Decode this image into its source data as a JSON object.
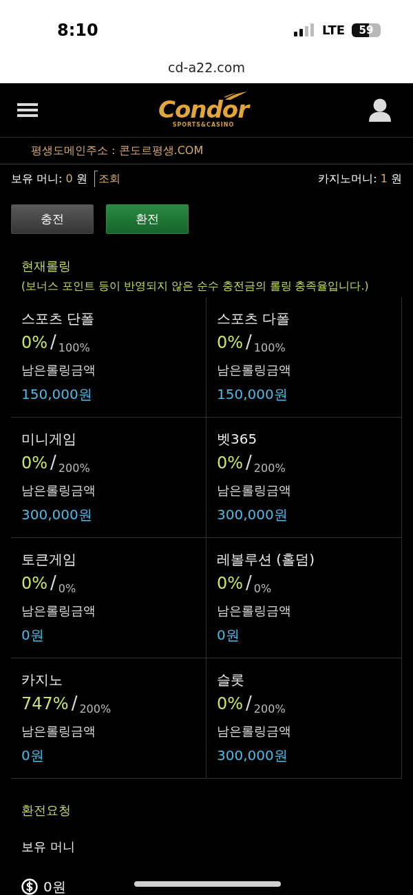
{
  "status_bar": {
    "time": "8:10",
    "network": "LTE",
    "battery": "59"
  },
  "browser": {
    "url": "cd-a22.com"
  },
  "header": {
    "logo": "Condor",
    "tagline": "SPORTS&CASINO"
  },
  "notice": "평생도메인주소 : 콘도르평생.COM",
  "balances": {
    "holding": {
      "label": "보유 머니:",
      "amount": "0",
      "unit": "원"
    },
    "lookup": "조회",
    "casino": {
      "label": "카지노머니:",
      "amount": "1",
      "unit": "원"
    }
  },
  "actions": [
    {
      "label": "충전",
      "selected": false
    },
    {
      "label": "환전",
      "selected": true
    }
  ],
  "rolling": {
    "title": "현재롤링",
    "note": "(보너스 포인트 등이 반영되지 않은 순수 충전금의 롤링 충족율입니다.)",
    "cells": [
      {
        "name": "스포츠 단폴",
        "current": "0%",
        "separator": "/",
        "target": "100%",
        "remaining_label": "남은롤링금액",
        "remaining": "150,000원"
      },
      {
        "name": "스포츠 다폴",
        "current": "0%",
        "separator": "/",
        "target": "100%",
        "remaining_label": "남은롤링금액",
        "remaining": "150,000원"
      },
      {
        "name": "미니게임",
        "current": "0%",
        "separator": "/",
        "target": "200%",
        "remaining_label": "남은롤링금액",
        "remaining": "300,000원"
      },
      {
        "name": "벳365",
        "current": "0%",
        "separator": "/",
        "target": "200%",
        "remaining_label": "남은롤링금액",
        "remaining": "300,000원"
      },
      {
        "name": "토큰게임",
        "current": "0%",
        "separator": "/",
        "target": "0%",
        "remaining_label": "남은롤링금액",
        "remaining": "0원"
      },
      {
        "name": "레볼루션 (홀덤)",
        "current": "0%",
        "separator": "/",
        "target": "0%",
        "remaining_label": "남은롤링금액",
        "remaining": "0원"
      },
      {
        "name": "카지노",
        "current": "747%",
        "separator": "/",
        "target": "200%",
        "remaining_label": "남은롤링금액",
        "remaining": "0원"
      },
      {
        "name": "슬롯",
        "current": "0%",
        "separator": "/",
        "target": "200%",
        "remaining_label": "남은롤링금액",
        "remaining": "300,000원"
      }
    ]
  },
  "exchange_request": {
    "title": "환전요청",
    "label": "보유 머니",
    "amount": "0원"
  }
}
